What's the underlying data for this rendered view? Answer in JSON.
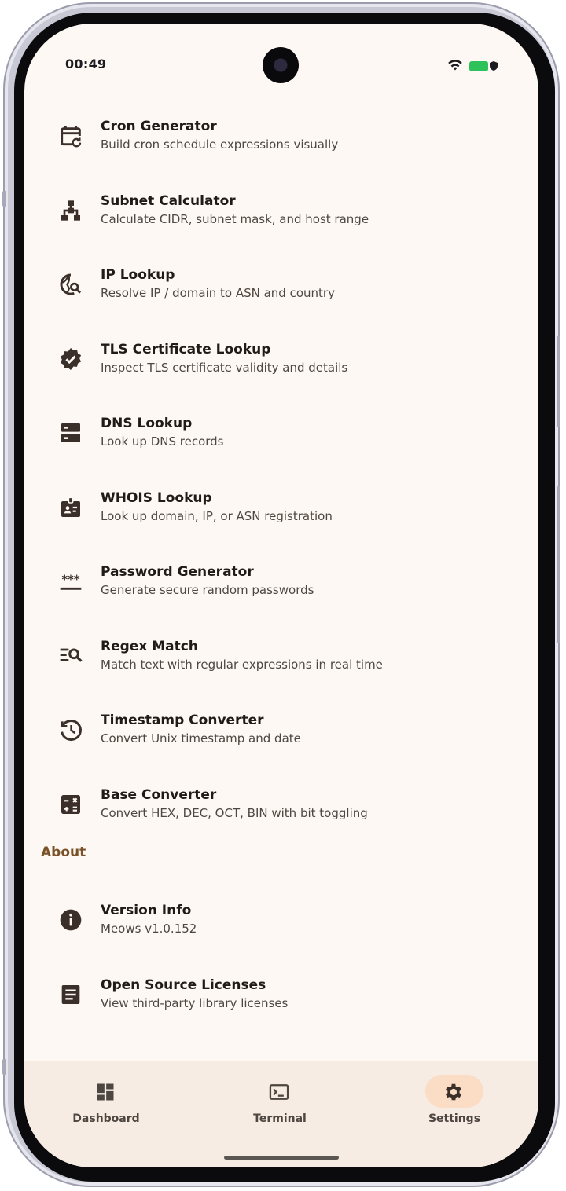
{
  "status_bar": {
    "time": "00:49",
    "battery_color": "#2fc15a"
  },
  "tools": [
    {
      "icon": "calendar-refresh-icon",
      "title": "Cron Generator",
      "subtitle": "Build cron schedule expressions visually"
    },
    {
      "icon": "network-tree-icon",
      "title": "Subnet Calculator",
      "subtitle": "Calculate CIDR, subnet mask, and host range"
    },
    {
      "icon": "globe-search-icon",
      "title": "IP Lookup",
      "subtitle": "Resolve IP / domain to ASN and country"
    },
    {
      "icon": "verified-badge-icon",
      "title": "TLS Certificate Lookup",
      "subtitle": "Inspect TLS certificate validity and details"
    },
    {
      "icon": "dns-server-icon",
      "title": "DNS Lookup",
      "subtitle": "Look up DNS records"
    },
    {
      "icon": "id-badge-icon",
      "title": "WHOIS Lookup",
      "subtitle": "Look up domain, IP, or ASN registration"
    },
    {
      "icon": "password-icon",
      "title": "Password Generator",
      "subtitle": "Generate secure random passwords"
    },
    {
      "icon": "text-search-icon",
      "title": "Regex Match",
      "subtitle": "Match text with regular expressions in real time"
    },
    {
      "icon": "clock-history-icon",
      "title": "Timestamp Converter",
      "subtitle": "Convert Unix timestamp and date"
    },
    {
      "icon": "calculator-icon",
      "title": "Base Converter",
      "subtitle": "Convert HEX, DEC, OCT, BIN with bit toggling"
    }
  ],
  "about": {
    "header": "About",
    "items": [
      {
        "icon": "info-icon",
        "title": "Version Info",
        "subtitle": "Meows v1.0.152"
      },
      {
        "icon": "document-icon",
        "title": "Open Source Licenses",
        "subtitle": "View third-party library licenses"
      }
    ]
  },
  "nav": {
    "items": [
      {
        "icon": "dashboard-icon",
        "label": "Dashboard",
        "active": false
      },
      {
        "icon": "terminal-icon",
        "label": "Terminal",
        "active": false
      },
      {
        "icon": "settings-gear-icon",
        "label": "Settings",
        "active": true
      }
    ]
  },
  "colors": {
    "background": "#fdf8f4",
    "nav_background": "#f7ece4",
    "active_pill": "#fbdcc5",
    "section_header": "#7a5228",
    "icon": "#3b2f2a"
  }
}
